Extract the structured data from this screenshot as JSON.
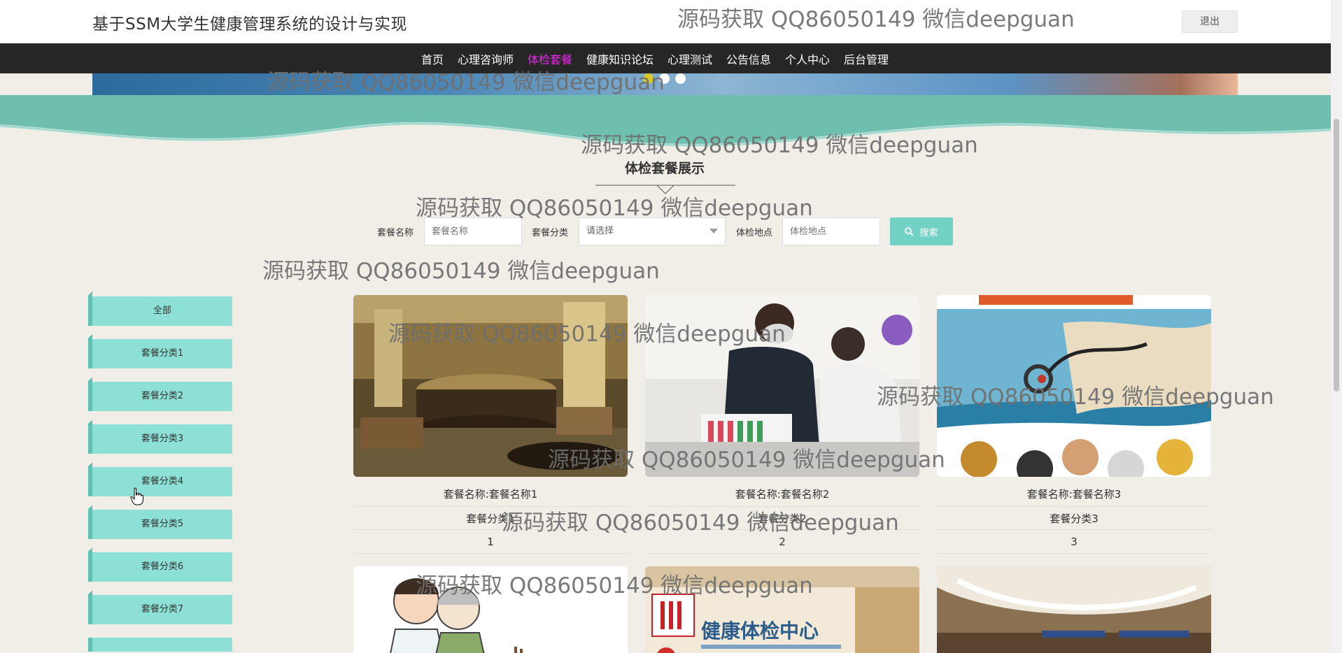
{
  "header": {
    "site_title": "基于SSM大学生健康管理系统的设计与实现",
    "logout_label": "退出"
  },
  "nav": {
    "items": [
      {
        "label": "首页"
      },
      {
        "label": "心理咨询师"
      },
      {
        "label": "体检套餐",
        "active": true
      },
      {
        "label": "健康知识论坛"
      },
      {
        "label": "心理测试"
      },
      {
        "label": "公告信息"
      },
      {
        "label": "个人中心"
      },
      {
        "label": "后台管理"
      }
    ],
    "active_color": "#ee28ee"
  },
  "banner": {
    "dots": 3,
    "active_dot": 0
  },
  "section": {
    "title": "体检套餐展示"
  },
  "search": {
    "name_label": "套餐名称",
    "name_placeholder": "套餐名称",
    "category_label": "套餐分类",
    "category_value": "请选择",
    "location_label": "体检地点",
    "location_placeholder": "体检地点",
    "button_label": "搜索"
  },
  "sidebar": {
    "items": [
      {
        "label": "全部"
      },
      {
        "label": "套餐分类1"
      },
      {
        "label": "套餐分类2"
      },
      {
        "label": "套餐分类3"
      },
      {
        "label": "套餐分类4"
      },
      {
        "label": "套餐分类5"
      },
      {
        "label": "套餐分类6"
      },
      {
        "label": "套餐分类7"
      }
    ]
  },
  "cards": [
    {
      "name": "套餐名称:套餐名称1",
      "category": "套餐分类1",
      "number": "1",
      "image": "reception-lobby"
    },
    {
      "name": "套餐名称:套餐名称2",
      "category": "套餐分类2",
      "number": "2",
      "image": "blood-test"
    },
    {
      "name": "套餐名称:套餐名称3",
      "category": "套餐分类3",
      "number": "3",
      "image": "stethoscope-collage"
    }
  ],
  "cards_row2": [
    {
      "image": "cartoon-doctor"
    },
    {
      "image": "health-checkup-center",
      "sign": "健康体检中心"
    },
    {
      "image": "hospital-hall"
    }
  ],
  "watermark": {
    "text": "源码获取 QQ86050149 微信deepguan"
  },
  "colors": {
    "navbar": "#262626",
    "accent": "#72d2c6",
    "sidebar": "#8de0d5",
    "wave": "#6ebfae",
    "background": "#f1eee8"
  }
}
